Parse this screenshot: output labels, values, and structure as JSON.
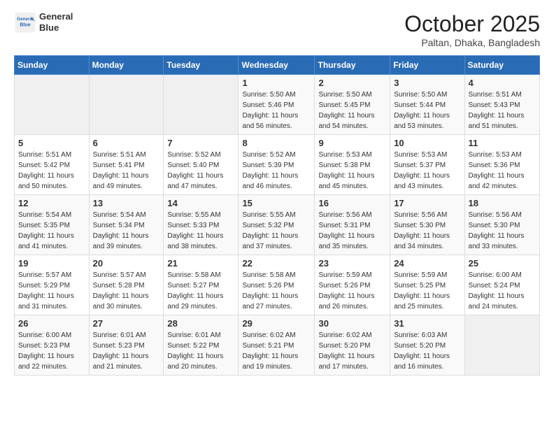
{
  "header": {
    "logo": {
      "line1": "General",
      "line2": "Blue"
    },
    "title": "October 2025",
    "location": "Paltan, Dhaka, Bangladesh"
  },
  "weekdays": [
    "Sunday",
    "Monday",
    "Tuesday",
    "Wednesday",
    "Thursday",
    "Friday",
    "Saturday"
  ],
  "weeks": [
    [
      {
        "day": "",
        "info": ""
      },
      {
        "day": "",
        "info": ""
      },
      {
        "day": "",
        "info": ""
      },
      {
        "day": "1",
        "info": "Sunrise: 5:50 AM\nSunset: 5:46 PM\nDaylight: 11 hours\nand 56 minutes."
      },
      {
        "day": "2",
        "info": "Sunrise: 5:50 AM\nSunset: 5:45 PM\nDaylight: 11 hours\nand 54 minutes."
      },
      {
        "day": "3",
        "info": "Sunrise: 5:50 AM\nSunset: 5:44 PM\nDaylight: 11 hours\nand 53 minutes."
      },
      {
        "day": "4",
        "info": "Sunrise: 5:51 AM\nSunset: 5:43 PM\nDaylight: 11 hours\nand 51 minutes."
      }
    ],
    [
      {
        "day": "5",
        "info": "Sunrise: 5:51 AM\nSunset: 5:42 PM\nDaylight: 11 hours\nand 50 minutes."
      },
      {
        "day": "6",
        "info": "Sunrise: 5:51 AM\nSunset: 5:41 PM\nDaylight: 11 hours\nand 49 minutes."
      },
      {
        "day": "7",
        "info": "Sunrise: 5:52 AM\nSunset: 5:40 PM\nDaylight: 11 hours\nand 47 minutes."
      },
      {
        "day": "8",
        "info": "Sunrise: 5:52 AM\nSunset: 5:39 PM\nDaylight: 11 hours\nand 46 minutes."
      },
      {
        "day": "9",
        "info": "Sunrise: 5:53 AM\nSunset: 5:38 PM\nDaylight: 11 hours\nand 45 minutes."
      },
      {
        "day": "10",
        "info": "Sunrise: 5:53 AM\nSunset: 5:37 PM\nDaylight: 11 hours\nand 43 minutes."
      },
      {
        "day": "11",
        "info": "Sunrise: 5:53 AM\nSunset: 5:36 PM\nDaylight: 11 hours\nand 42 minutes."
      }
    ],
    [
      {
        "day": "12",
        "info": "Sunrise: 5:54 AM\nSunset: 5:35 PM\nDaylight: 11 hours\nand 41 minutes."
      },
      {
        "day": "13",
        "info": "Sunrise: 5:54 AM\nSunset: 5:34 PM\nDaylight: 11 hours\nand 39 minutes."
      },
      {
        "day": "14",
        "info": "Sunrise: 5:55 AM\nSunset: 5:33 PM\nDaylight: 11 hours\nand 38 minutes."
      },
      {
        "day": "15",
        "info": "Sunrise: 5:55 AM\nSunset: 5:32 PM\nDaylight: 11 hours\nand 37 minutes."
      },
      {
        "day": "16",
        "info": "Sunrise: 5:56 AM\nSunset: 5:31 PM\nDaylight: 11 hours\nand 35 minutes."
      },
      {
        "day": "17",
        "info": "Sunrise: 5:56 AM\nSunset: 5:30 PM\nDaylight: 11 hours\nand 34 minutes."
      },
      {
        "day": "18",
        "info": "Sunrise: 5:56 AM\nSunset: 5:30 PM\nDaylight: 11 hours\nand 33 minutes."
      }
    ],
    [
      {
        "day": "19",
        "info": "Sunrise: 5:57 AM\nSunset: 5:29 PM\nDaylight: 11 hours\nand 31 minutes."
      },
      {
        "day": "20",
        "info": "Sunrise: 5:57 AM\nSunset: 5:28 PM\nDaylight: 11 hours\nand 30 minutes."
      },
      {
        "day": "21",
        "info": "Sunrise: 5:58 AM\nSunset: 5:27 PM\nDaylight: 11 hours\nand 29 minutes."
      },
      {
        "day": "22",
        "info": "Sunrise: 5:58 AM\nSunset: 5:26 PM\nDaylight: 11 hours\nand 27 minutes."
      },
      {
        "day": "23",
        "info": "Sunrise: 5:59 AM\nSunset: 5:26 PM\nDaylight: 11 hours\nand 26 minutes."
      },
      {
        "day": "24",
        "info": "Sunrise: 5:59 AM\nSunset: 5:25 PM\nDaylight: 11 hours\nand 25 minutes."
      },
      {
        "day": "25",
        "info": "Sunrise: 6:00 AM\nSunset: 5:24 PM\nDaylight: 11 hours\nand 24 minutes."
      }
    ],
    [
      {
        "day": "26",
        "info": "Sunrise: 6:00 AM\nSunset: 5:23 PM\nDaylight: 11 hours\nand 22 minutes."
      },
      {
        "day": "27",
        "info": "Sunrise: 6:01 AM\nSunset: 5:23 PM\nDaylight: 11 hours\nand 21 minutes."
      },
      {
        "day": "28",
        "info": "Sunrise: 6:01 AM\nSunset: 5:22 PM\nDaylight: 11 hours\nand 20 minutes."
      },
      {
        "day": "29",
        "info": "Sunrise: 6:02 AM\nSunset: 5:21 PM\nDaylight: 11 hours\nand 19 minutes."
      },
      {
        "day": "30",
        "info": "Sunrise: 6:02 AM\nSunset: 5:20 PM\nDaylight: 11 hours\nand 17 minutes."
      },
      {
        "day": "31",
        "info": "Sunrise: 6:03 AM\nSunset: 5:20 PM\nDaylight: 11 hours\nand 16 minutes."
      },
      {
        "day": "",
        "info": ""
      }
    ]
  ]
}
